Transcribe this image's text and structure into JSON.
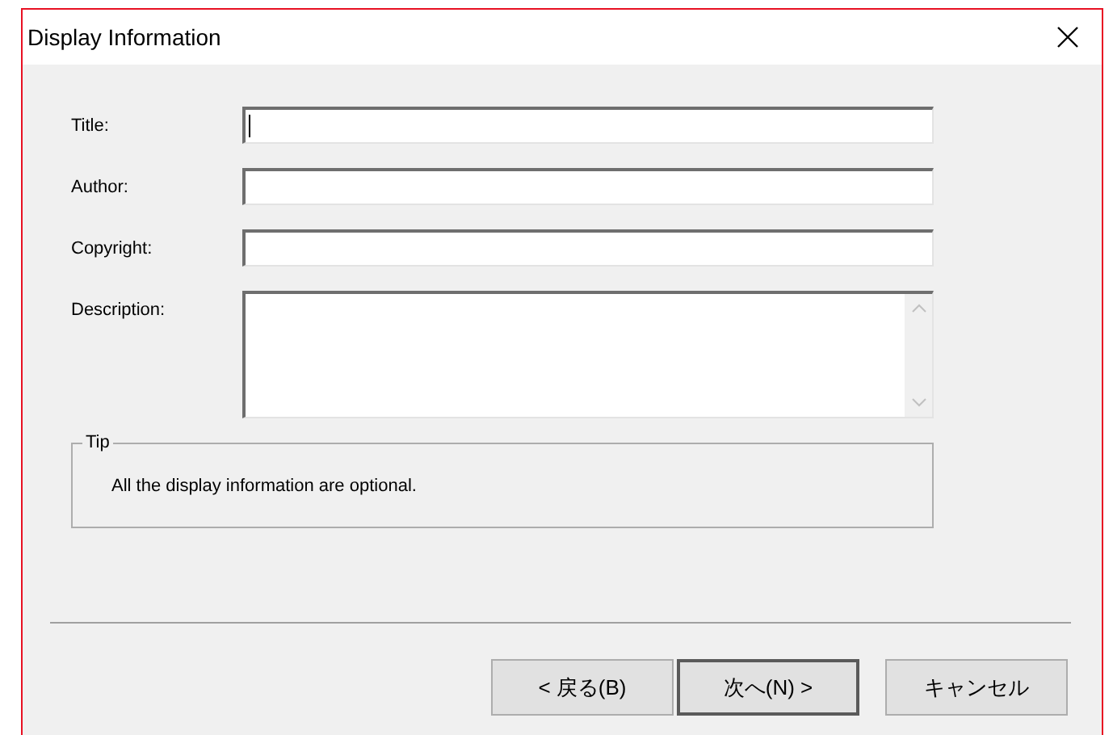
{
  "window": {
    "title": "Display Information"
  },
  "fields": [
    {
      "label": "Title:",
      "kind": "line",
      "focused": true
    },
    {
      "label": "Author:",
      "kind": "line",
      "focused": false
    },
    {
      "label": "Copyright:",
      "kind": "line",
      "focused": false
    },
    {
      "label": "Description:",
      "kind": "multiline",
      "focused": false
    }
  ],
  "tip": {
    "title": "Tip",
    "text": "All the display information are optional."
  },
  "buttons": [
    {
      "label": "< 戻る(B)",
      "default": false
    },
    {
      "label": "次へ(N) >",
      "default": true
    },
    {
      "label": "キャンセル",
      "default": false
    }
  ]
}
